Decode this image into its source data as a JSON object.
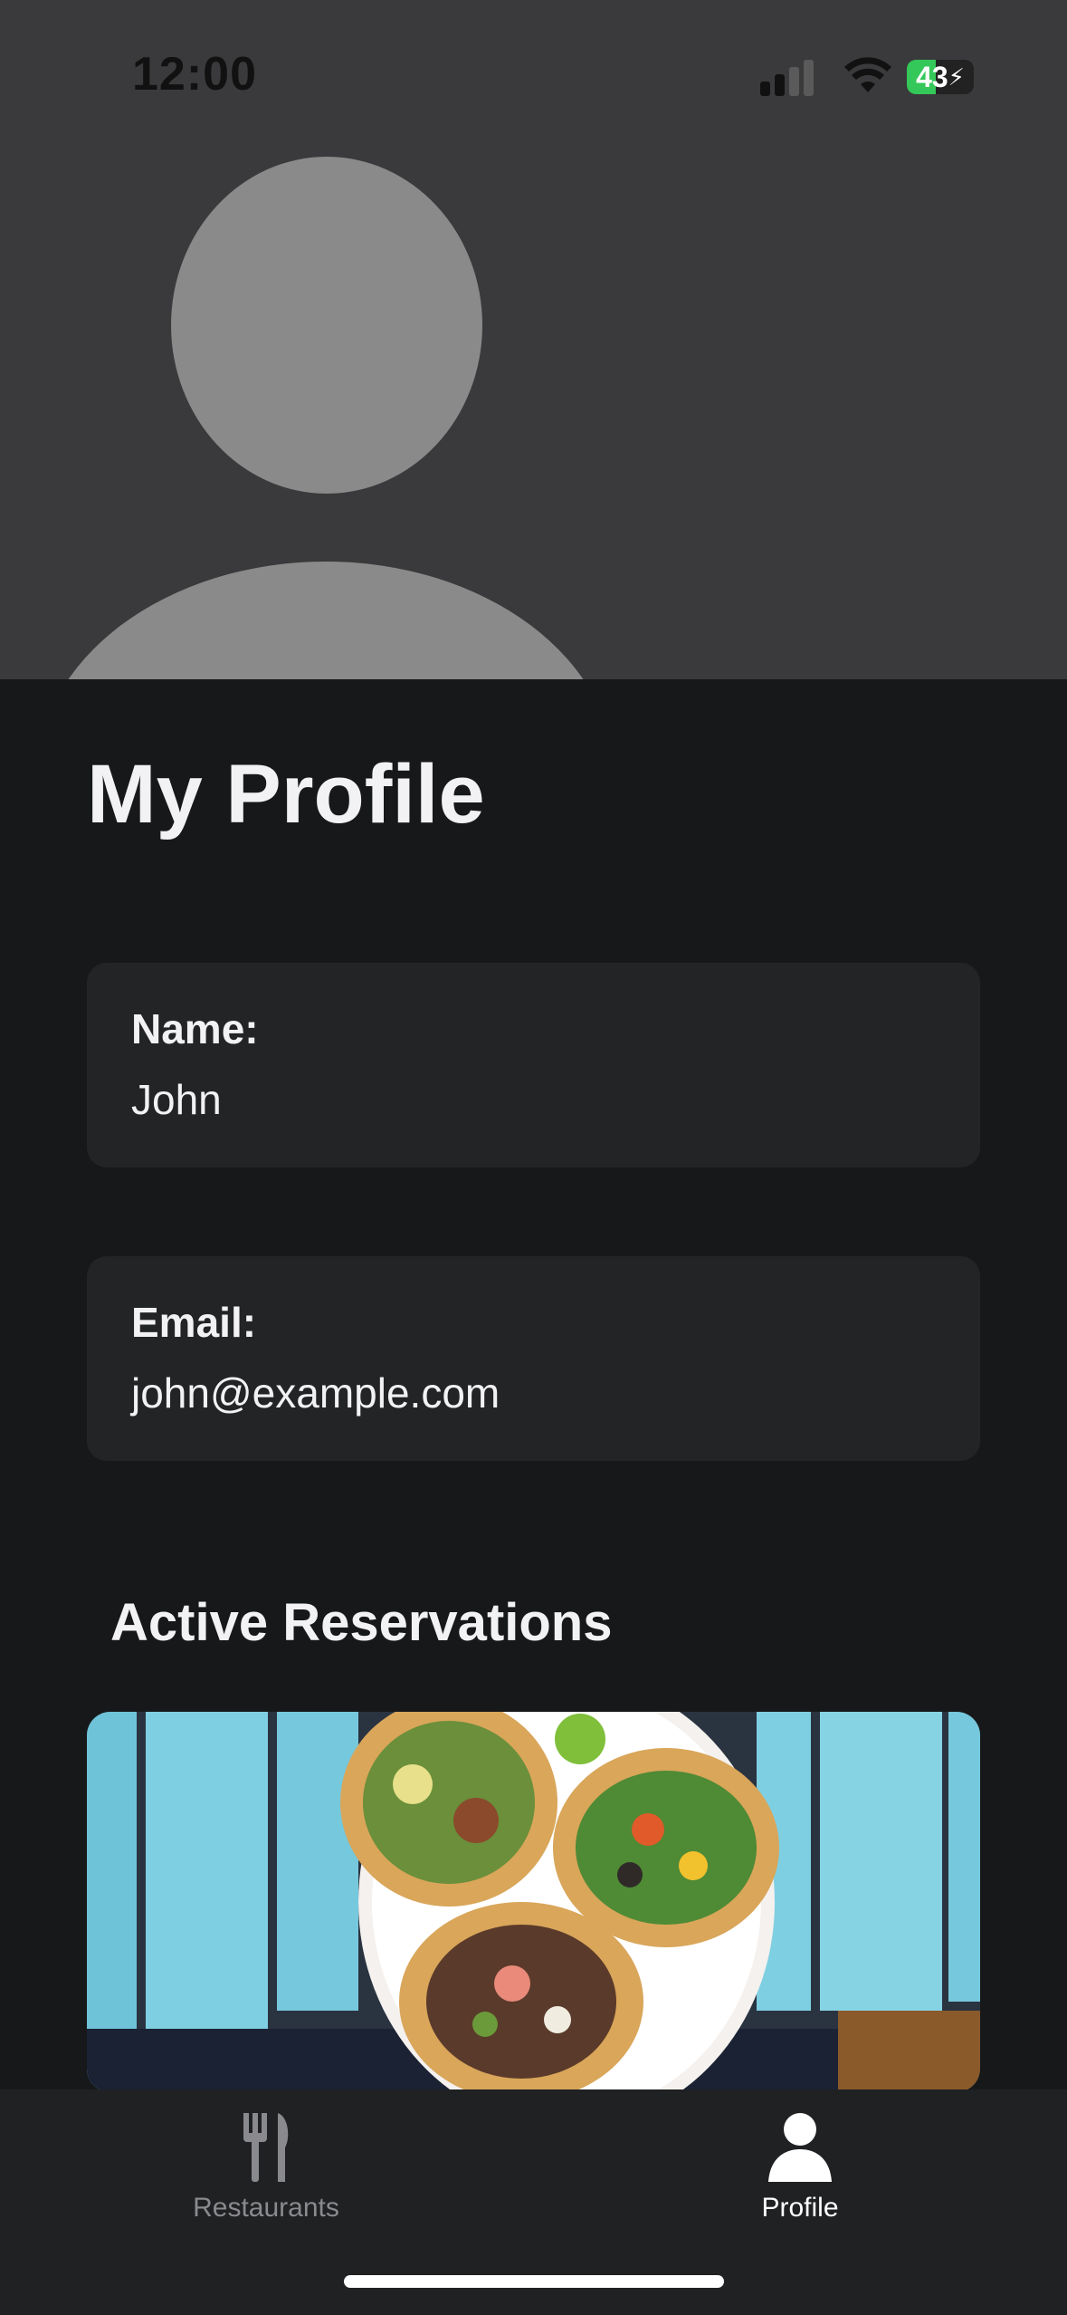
{
  "status_bar": {
    "time": "12:00",
    "battery_level": "43",
    "battery_fraction": 0.43,
    "signal_bars_active": 2,
    "icons": [
      "cellular-signal-icon",
      "wifi-icon",
      "battery-charging-icon"
    ]
  },
  "profile": {
    "title": "My Profile",
    "name_label": "Name:",
    "name_value": "John",
    "email_label": "Email:",
    "email_value": "john@example.com"
  },
  "reservations": {
    "section_title": "Active Reservations"
  },
  "tab_bar": {
    "tabs": [
      {
        "label": "Restaurants",
        "icon": "fork-knife-icon",
        "active": false
      },
      {
        "label": "Profile",
        "icon": "person-icon",
        "active": true
      }
    ]
  },
  "colors": {
    "background": "#17181a",
    "header_background": "#3a3a3c",
    "avatar_placeholder": "#8a8a8a",
    "card_background": "#232426",
    "tab_active": "#ffffff",
    "tab_inactive": "#8a8a8e",
    "battery_green": "#34c759"
  }
}
